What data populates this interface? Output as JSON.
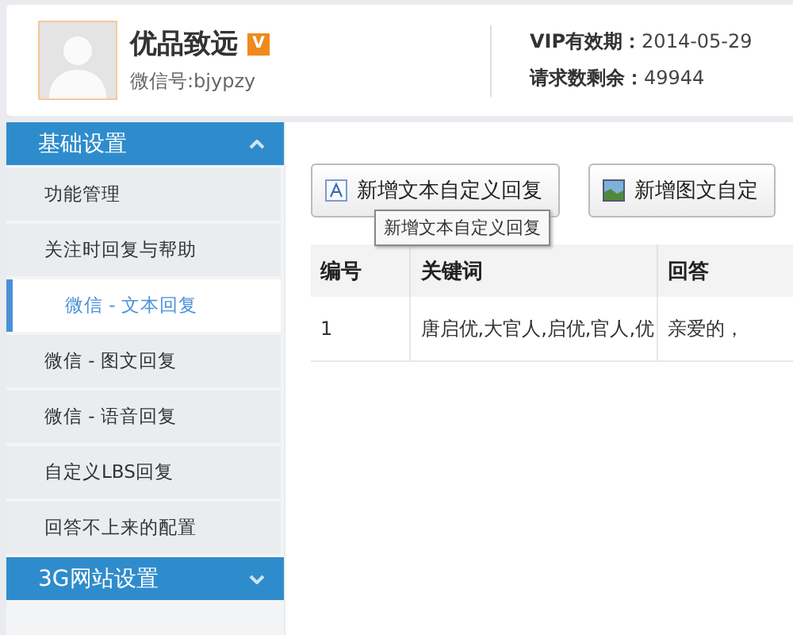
{
  "account": {
    "name": "优品致远",
    "badge": "V",
    "wechat_id": "微信号:bjypzy"
  },
  "stats": [
    {
      "label": "VIP有效期：",
      "value": "2014-05-29"
    },
    {
      "label": "请求数剩余：",
      "value": "49944"
    }
  ],
  "sidebar": [
    {
      "title": "基础设置",
      "expanded": true,
      "items": [
        {
          "label": "功能管理",
          "selected": false,
          "sub": false
        },
        {
          "label": "关注时回复与帮助",
          "selected": false,
          "sub": false
        },
        {
          "label": "微信 - 文本回复",
          "selected": true,
          "sub": true
        },
        {
          "label": "微信 - 图文回复",
          "selected": false,
          "sub": false
        },
        {
          "label": "微信 - 语音回复",
          "selected": false,
          "sub": false
        },
        {
          "label": "自定义LBS回复",
          "selected": false,
          "sub": false
        },
        {
          "label": "回答不上来的配置",
          "selected": false,
          "sub": false
        }
      ]
    },
    {
      "title": "3G网站设置",
      "expanded": false
    }
  ],
  "buttons": [
    {
      "kind": "text",
      "label": "新增文本自定义回复"
    },
    {
      "kind": "image",
      "label": "新增图文自定"
    }
  ],
  "tooltip": "新增文本自定义回复",
  "table": {
    "columns": [
      "编号",
      "关键词",
      "回答"
    ],
    "rows": [
      [
        "1",
        "唐启优,大官人,启优,官人,优",
        "亲爱的，"
      ]
    ]
  }
}
